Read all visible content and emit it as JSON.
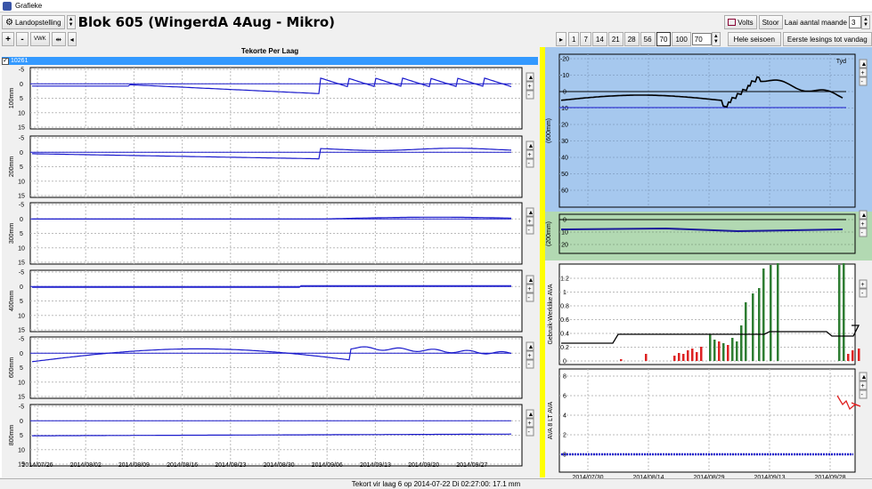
{
  "window": {
    "title": "Grafieke"
  },
  "toolbar": {
    "landopstelling_label": "Landopstelling",
    "block_title": "Blok 605 (WingerdA 4Aug - Mikro)",
    "volts_label": "Volts",
    "stoor_label": "Stoor",
    "laai_label": "Laai aantal maande",
    "laai_value": "3",
    "plus_label": "+",
    "minus_label": "-",
    "vwk_label": "VWK",
    "period_buttons": [
      "1",
      "7",
      "14",
      "21",
      "28",
      "56",
      "70",
      "100"
    ],
    "period_value": "70",
    "hele_seisoen_label": "Hele seisoen",
    "eerste_lesings_label": "Eerste lesings tot vandag"
  },
  "left": {
    "header": "Tekorte Per Laag",
    "checkbar_label": "10261",
    "ytick_labels": [
      "-5",
      "0",
      "5",
      "10",
      "15"
    ],
    "panels": [
      {
        "label": "100mm"
      },
      {
        "label": "200mm"
      },
      {
        "label": "300mm"
      },
      {
        "label": "400mm"
      },
      {
        "label": "600mm"
      },
      {
        "label": "800mm"
      }
    ],
    "xtick_labels": [
      "2014/07/26",
      "2014/08/02",
      "2014/08/09",
      "2014/08/16",
      "2014/08/23",
      "2014/08/30",
      "2014/09/06",
      "2014/09/13",
      "2014/09/20",
      "2014/09/27"
    ]
  },
  "right": {
    "top_panel": {
      "label": "(600mm)",
      "tyd_label": "Tyd",
      "ytick_labels": [
        "-20",
        "-10",
        "0",
        "10",
        "20",
        "30",
        "40",
        "50",
        "60"
      ],
      "bg": "#a6c8ee"
    },
    "mid_panel": {
      "label": "(200mm)",
      "ytick_labels": [
        "0",
        "10",
        "20"
      ],
      "bg": "#b2d9b2"
    },
    "bar_panel": {
      "label": "Gebruik-Werklike AVA",
      "ytick_labels": [
        "1.2",
        "1",
        "0.8",
        "0.6",
        "0.4",
        "0.2",
        "0"
      ]
    },
    "ava_panel": {
      "label": "AVA 8 LT AVA",
      "ytick_labels": [
        "8",
        "6",
        "4",
        "2",
        "0"
      ]
    },
    "xtick_labels": [
      "2014/07/30",
      "2014/08/14",
      "2014/08/29",
      "2014/09/13",
      "2014/09/28"
    ]
  },
  "status": {
    "text": "Tekort vir laag 6 op 2014-07-22 Di 02:27:00: 17.1 mm"
  },
  "colors": {
    "line": "#1a1acc",
    "divider": "#ffff00",
    "bar_green": "#2e7d32",
    "bar_red": "#dd2222",
    "ava_red": "#e02020"
  }
}
